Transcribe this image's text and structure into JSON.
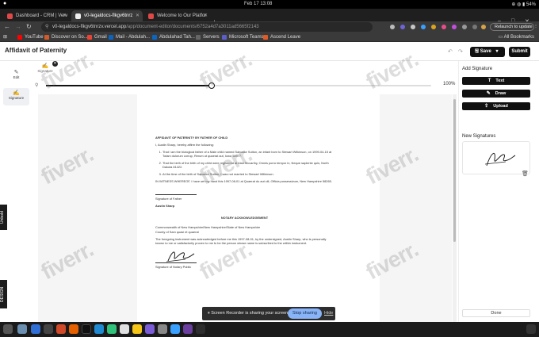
{
  "os_bar": {
    "activities": "●",
    "clock": "Feb 17  13:08",
    "battery": "54%"
  },
  "tabs": [
    {
      "label": "Dashboard - CRM | Verv",
      "active": false,
      "color": "#e04848"
    },
    {
      "label": "v0-legaldocs-flkgv6tnrz",
      "active": true,
      "color": "#222222"
    },
    {
      "label": "Welcome to Our Platfor",
      "active": false,
      "color": "#e04848"
    }
  ],
  "address_bar": {
    "domain": "v0-legaldocs-flkgv6tnrzv.vercel.app",
    "path": "/app/document-editor/documents/6752a4d7a3011ad5665f2143",
    "relaunch_label": "Relaunch to update"
  },
  "bookmarks": [
    {
      "label": "YouTube",
      "color": "#ff0000"
    },
    {
      "label": "Discover on So...",
      "color": "#d05a2a"
    },
    {
      "label": "Gmail",
      "color": "#ea4335"
    },
    {
      "label": "Mail - Abdulah...",
      "color": "#0a64c0"
    },
    {
      "label": "Abdulahad Tah...",
      "color": "#0a66c2"
    },
    {
      "label": "Servers",
      "color": "#666666"
    },
    {
      "label": "Microsoft Teams",
      "color": "#5b5fc7"
    },
    {
      "label": "Ascend Leave",
      "color": "#e05a28"
    }
  ],
  "all_bookmarks": "All Bookmarks",
  "header": {
    "title": "Affidavit of Paternity",
    "save": "Save",
    "submit": "Submit"
  },
  "left_tools": [
    {
      "label": "Edit",
      "icon": "edit-icon"
    },
    {
      "label": "Signature",
      "icon": "signature-icon"
    }
  ],
  "left_edge": {
    "tab1": "Unbold",
    "tab2": "DESIGN"
  },
  "signature_tab": {
    "label": "Signature"
  },
  "zoom": {
    "level": 1.0,
    "value_label": "100%"
  },
  "document": {
    "heading": "AFFIDAVIT OF PATERNITY BY FATHER OF CHILD",
    "intro": "I, Austin Sharp, hereby affirm the following:",
    "items": [
      "That I am the biological father of a Male child named Salvador Sutton, an infant born to Stewart Wilkinson, on 1999-04-15 at Totam dolorum corrup, Rerum ut quaerat aut, Iowa 58977.",
      "That the birth of the birth of my child were registered at Alan Mccarthy, Omnis porro tempor in, Neque sapiente quis, North Dakota 81422.",
      "At the time of the birth of Salvador Sutton, I was not married to Stewart Wilkinson."
    ],
    "witness": "IN WITNESS WHEREOF, I have set my hand this 1997-08-01 at Quaerat do aut cili, Officia possessivum, New Hampshire 58265.",
    "sig_father": "Signature of Father",
    "father_name": "Austin Sharp",
    "notary_heading": "NOTARY ACKNOWLEDGEMENT",
    "commonwealth": "Commonwealth of New Hampshire/New Hampshire/State of New Hampshire",
    "county": "County of Sam quasi et quaerat",
    "notary_text": "The foregoing instrument was acknowledged before me this 1997-08-01, by the undersigned, Austin Sharp, who is personally known to me or satisfactorily proven to me to be the person whose name is subscribed to the within instrument.",
    "sig_notary": "Signature of Notary Public"
  },
  "right_panel": {
    "add_title": "Add Signature",
    "buttons": [
      {
        "label": "Text",
        "icon": "text-icon"
      },
      {
        "label": "Draw",
        "icon": "pen-icon"
      },
      {
        "label": "Upload",
        "icon": "upload-icon"
      }
    ],
    "new_title": "New Signatures",
    "done": "Done"
  },
  "share": {
    "text": "Screen Recorder is sharing your screen.",
    "stop": "Stop sharing",
    "hide": "Hide"
  },
  "watermark": "fiverr."
}
